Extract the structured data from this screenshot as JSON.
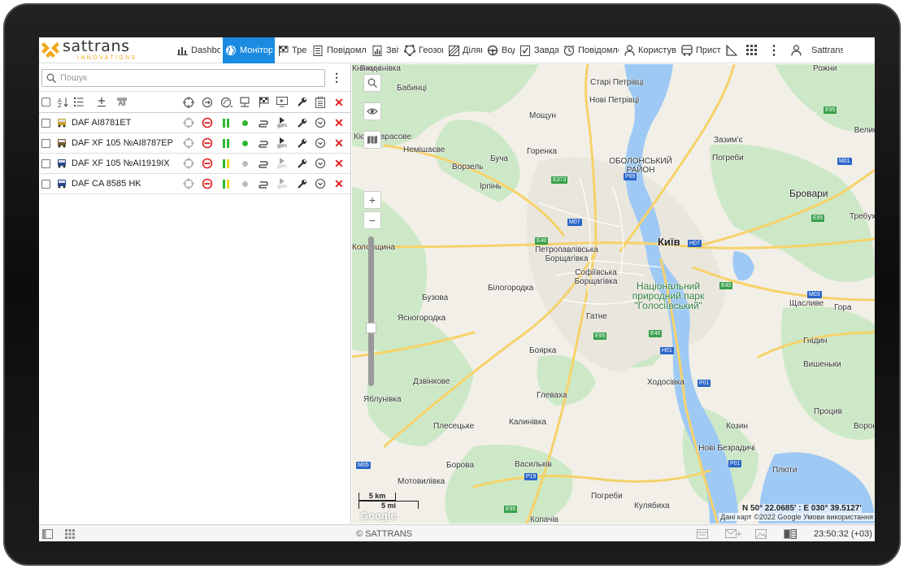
{
  "app": {
    "logo_text": "sattrans",
    "logo_sub": "INNOVATIONS",
    "brand_orange": "#f2a81d",
    "accent_blue": "#1a8be0"
  },
  "tabs": [
    {
      "label": "Dashboard",
      "icon": "bar-chart-icon"
    },
    {
      "label": "Моніторинг",
      "icon": "globe-icon",
      "active": true
    },
    {
      "label": "Треки",
      "icon": "checkered-flag-icon"
    },
    {
      "label": "Повідомлення",
      "icon": "document-icon"
    },
    {
      "label": "Звіти",
      "icon": "report-icon"
    },
    {
      "label": "Геозони",
      "icon": "geofence-icon"
    },
    {
      "label": "Ділянки",
      "icon": "area-icon"
    },
    {
      "label": "Водії",
      "icon": "steering-wheel-icon"
    },
    {
      "label": "Завдання",
      "icon": "checklist-icon"
    },
    {
      "label": "Повідомлення",
      "icon": "alarm-clock-icon"
    },
    {
      "label": "Користувачі",
      "icon": "user-icon"
    },
    {
      "label": "Пристрої",
      "icon": "bus-icon"
    },
    {
      "label": "",
      "icon": "ruler-icon"
    },
    {
      "label": "",
      "icon": "apps-grid-icon"
    },
    {
      "label": "⋮",
      "icon": "more-icon"
    },
    {
      "label": "Sattrans",
      "icon": "account-icon"
    }
  ],
  "search": {
    "placeholder": "Пошук"
  },
  "header_icons": [
    "sort-az-icon",
    "list-icon",
    "add-group-icon",
    "all-icon",
    "crosshair-icon",
    "command-icon",
    "satellite-icon",
    "device-icon",
    "flag-icon",
    "video-icon",
    "wrench-icon",
    "clipboard-icon",
    "delete-icon"
  ],
  "all_label": "All",
  "units": [
    {
      "name": "DAF AI8781ET",
      "icon_color": "#c9a227",
      "sig1": "#2eb82e",
      "sig2": "#2eb82e",
      "dot": "#2eb82e",
      "gprs_active": true
    },
    {
      "name": "DAF XF 105 №AI8787EP",
      "icon_color": "#7a5a2a",
      "sig1": "#2eb82e",
      "sig2": "#2eb82e",
      "dot": "#2eb82e",
      "gprs_active": true
    },
    {
      "name": "DAF XF 105 №AI1919IX",
      "icon_color": "#2b4a8a",
      "sig1": "#2eb82e",
      "sig2": "#e5d92a",
      "dot": "#bbbbbb",
      "gprs_active": false
    },
    {
      "name": "DAF CA 8585 HK",
      "icon_color": "#2b4a8a",
      "sig1": "#2eb82e",
      "sig2": "#e5d92a",
      "dot": "#bbbbbb",
      "gprs_active": false
    }
  ],
  "gprs_label": "gprs",
  "map": {
    "places": [
      {
        "t": "Бабинці",
        "cls": ""
      },
      {
        "t": "Старі Петрівці",
        "cls": ""
      },
      {
        "t": "Нові Петрівці",
        "cls": ""
      },
      {
        "t": "Мощун",
        "cls": ""
      },
      {
        "t": "Кієво-Тарасове",
        "cls": ""
      },
      {
        "t": "Немішаєве",
        "cls": ""
      },
      {
        "t": "Горенка",
        "cls": ""
      },
      {
        "t": "ОБОЛОНСЬКИЙ РАЙОН",
        "cls": ""
      },
      {
        "t": "Буча",
        "cls": ""
      },
      {
        "t": "Ворзель",
        "cls": ""
      },
      {
        "t": "Ірпінь",
        "cls": ""
      },
      {
        "t": "Погреби",
        "cls": ""
      },
      {
        "t": "Зазим'є",
        "cls": ""
      },
      {
        "t": "Бровари",
        "cls": "city"
      },
      {
        "t": "Київ",
        "cls": "big"
      },
      {
        "t": "Требухів",
        "cls": ""
      },
      {
        "t": "Петропавлівська Борщагівка",
        "cls": ""
      },
      {
        "t": "Софіївська Борщагівка",
        "cls": ""
      },
      {
        "t": "Бузова",
        "cls": ""
      },
      {
        "t": "Білогородка",
        "cls": ""
      },
      {
        "t": "Ясногородка",
        "cls": ""
      },
      {
        "t": "Гатне",
        "cls": ""
      },
      {
        "t": "Національний природний парк \"Голосіївський\"",
        "cls": "park"
      },
      {
        "t": "Щасливе",
        "cls": ""
      },
      {
        "t": "Гора",
        "cls": ""
      },
      {
        "t": "Гнідин",
        "cls": ""
      },
      {
        "t": "Боярка",
        "cls": ""
      },
      {
        "t": "Вишеньки",
        "cls": ""
      },
      {
        "t": "Дзвінкове",
        "cls": ""
      },
      {
        "t": "Ходосівка",
        "cls": ""
      },
      {
        "t": "Яблунівка",
        "cls": ""
      },
      {
        "t": "Глеваха",
        "cls": ""
      },
      {
        "t": "Процив",
        "cls": ""
      },
      {
        "t": "Плесецьке",
        "cls": ""
      },
      {
        "t": "Калинівка",
        "cls": ""
      },
      {
        "t": "Козин",
        "cls": ""
      },
      {
        "t": "Вороньків",
        "cls": ""
      },
      {
        "t": "Нові Безрадичі",
        "cls": ""
      },
      {
        "t": "Борова",
        "cls": ""
      },
      {
        "t": "Васильків",
        "cls": ""
      },
      {
        "t": "Плюти",
        "cls": ""
      },
      {
        "t": "Мотовилівка",
        "cls": ""
      },
      {
        "t": "Погреби",
        "cls": ""
      },
      {
        "t": "Кулябиха",
        "cls": ""
      },
      {
        "t": "Копачів",
        "cls": ""
      },
      {
        "t": "Рожни",
        "cls": ""
      },
      {
        "t": "Велика Димерка",
        "cls": ""
      },
      {
        "t": "Богданівка",
        "cls": ""
      },
      {
        "t": "Колонщина",
        "cls": ""
      },
      {
        "t": "Княжичі",
        "cls": ""
      }
    ],
    "shields": [
      "E95",
      "M01",
      "E40",
      "M07",
      "E373",
      "P69",
      "H07",
      "E40",
      "M03",
      "E95",
      "E40",
      "H01",
      "P01",
      "E95",
      "P19",
      "P01",
      "E95",
      "M05"
    ],
    "scale_km": "5 km",
    "scale_mi": "5 mi",
    "coords": "N 50° 22.0685' : E 030° 39.5127'",
    "attribution": "Дані карт ©2022 Google    Умови використання",
    "google": "Google",
    "colors": {
      "land": "#f1efe7",
      "forest": "#cde8c6",
      "water": "#9ec9f5",
      "road": "#f7d26a"
    }
  },
  "footer": {
    "copyright": "© SATTRANS",
    "time": "23:50:32 (+03)"
  }
}
